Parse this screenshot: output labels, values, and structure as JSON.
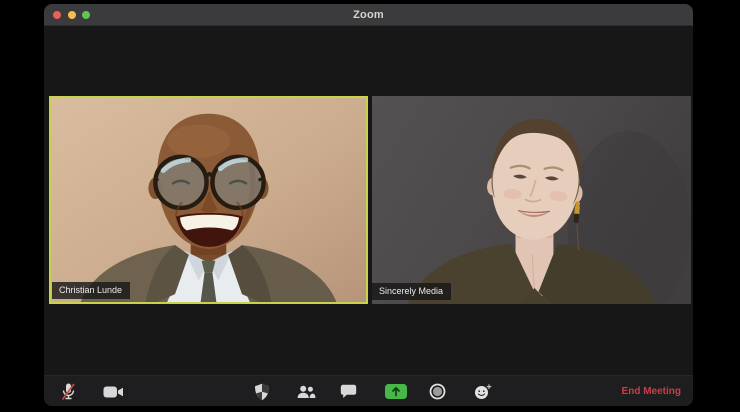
{
  "window": {
    "title": "Zoom"
  },
  "titlebar_controls": [
    "close",
    "minimize",
    "zoom"
  ],
  "participants": [
    {
      "name": "Christian Lunde",
      "active_speaker": true,
      "muted": false
    },
    {
      "name": "Sincerely Media",
      "active_speaker": false,
      "muted": false
    }
  ],
  "toolbar": {
    "items": [
      {
        "icon": "microphone-muted-icon"
      },
      {
        "icon": "video-camera-icon"
      },
      {
        "icon": "security-shield-icon"
      },
      {
        "icon": "participants-icon"
      },
      {
        "icon": "chat-icon"
      },
      {
        "icon": "share-screen-icon"
      },
      {
        "icon": "record-icon"
      },
      {
        "icon": "reactions-icon"
      }
    ],
    "end_meeting_label": "End Meeting"
  },
  "colors": {
    "active_speaker_border": "#c7d44b",
    "share_screen_green": "#47b748",
    "end_meeting_red": "#c73f47",
    "mute_slash_red": "#c94f44",
    "titlebar": "#3b3b3d",
    "content_background": "#171717",
    "toolbar_background": "#1e1e20"
  }
}
